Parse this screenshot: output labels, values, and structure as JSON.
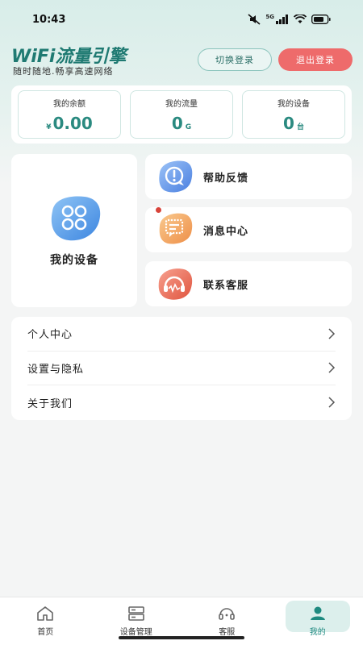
{
  "status_bar": {
    "time": "10:43",
    "network": "5G"
  },
  "header": {
    "brand_title": "WiFi流量引擎",
    "brand_subtitle": "随时随地.畅享高速网络",
    "switch_login_label": "切换登录",
    "logout_label": "退出登录"
  },
  "stats": {
    "balance": {
      "label": "我的余额",
      "prefix": "¥",
      "value": "0.00"
    },
    "traffic": {
      "label": "我的流量",
      "value": "0",
      "unit": "G"
    },
    "devices": {
      "label": "我的设备",
      "value": "0",
      "unit": "台"
    }
  },
  "device_card": {
    "label": "我的设备",
    "icon": "apps-grid-icon"
  },
  "quick_menu": [
    {
      "label": "帮助反馈",
      "icon": "help-feedback-icon",
      "color": "#5b8fe6"
    },
    {
      "label": "消息中心",
      "icon": "message-icon",
      "color": "#f0a25a"
    },
    {
      "label": "联系客服",
      "icon": "headset-icon",
      "color": "#ea6656"
    }
  ],
  "list_menu": [
    {
      "label": "个人中心"
    },
    {
      "label": "设置与隐私"
    },
    {
      "label": "关于我们"
    }
  ],
  "tabbar": [
    {
      "label": "首页",
      "icon": "home-icon"
    },
    {
      "label": "设备管理",
      "icon": "device-manage-icon"
    },
    {
      "label": "客服",
      "icon": "headset-icon"
    },
    {
      "label": "我的",
      "icon": "user-icon",
      "active": true
    }
  ],
  "colors": {
    "accent": "#2a8a80",
    "logout": "#ee6b6b",
    "active_tab": "#1f8a80"
  }
}
